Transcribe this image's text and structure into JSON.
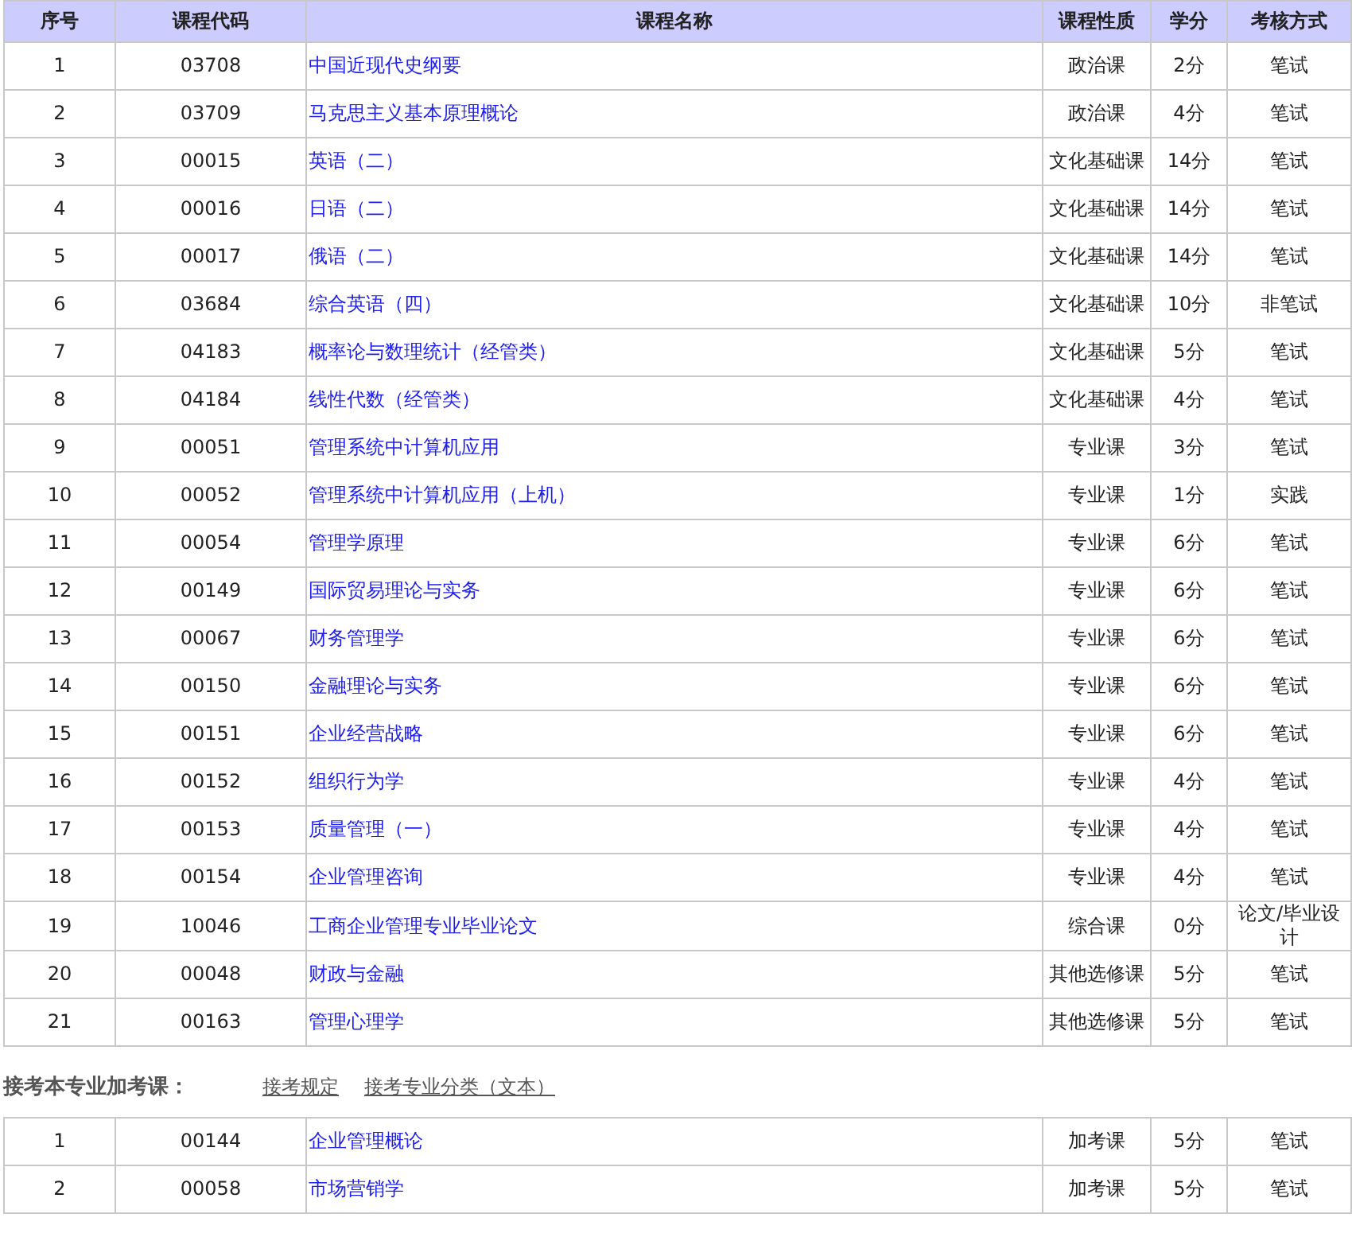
{
  "table": {
    "columns": [
      "序号",
      "课程代码",
      "课程名称",
      "课程性质",
      "学分",
      "考核方式"
    ],
    "rows": [
      [
        "1",
        "03708",
        "中国近现代史纲要",
        "政治课",
        "2分",
        "笔试"
      ],
      [
        "2",
        "03709",
        "马克思主义基本原理概论",
        "政治课",
        "4分",
        "笔试"
      ],
      [
        "3",
        "00015",
        "英语（二）",
        "文化基础课",
        "14分",
        "笔试"
      ],
      [
        "4",
        "00016",
        "日语（二）",
        "文化基础课",
        "14分",
        "笔试"
      ],
      [
        "5",
        "00017",
        "俄语（二）",
        "文化基础课",
        "14分",
        "笔试"
      ],
      [
        "6",
        "03684",
        "综合英语（四）",
        "文化基础课",
        "10分",
        "非笔试"
      ],
      [
        "7",
        "04183",
        "概率论与数理统计（经管类）",
        "文化基础课",
        "5分",
        "笔试"
      ],
      [
        "8",
        "04184",
        "线性代数（经管类）",
        "文化基础课",
        "4分",
        "笔试"
      ],
      [
        "9",
        "00051",
        "管理系统中计算机应用",
        "专业课",
        "3分",
        "笔试"
      ],
      [
        "10",
        "00052",
        "管理系统中计算机应用（上机）",
        "专业课",
        "1分",
        "实践"
      ],
      [
        "11",
        "00054",
        "管理学原理",
        "专业课",
        "6分",
        "笔试"
      ],
      [
        "12",
        "00149",
        "国际贸易理论与实务",
        "专业课",
        "6分",
        "笔试"
      ],
      [
        "13",
        "00067",
        "财务管理学",
        "专业课",
        "6分",
        "笔试"
      ],
      [
        "14",
        "00150",
        "金融理论与实务",
        "专业课",
        "6分",
        "笔试"
      ],
      [
        "15",
        "00151",
        "企业经营战略",
        "专业课",
        "6分",
        "笔试"
      ],
      [
        "16",
        "00152",
        "组织行为学",
        "专业课",
        "4分",
        "笔试"
      ],
      [
        "17",
        "00153",
        "质量管理（一）",
        "专业课",
        "4分",
        "笔试"
      ],
      [
        "18",
        "00154",
        "企业管理咨询",
        "专业课",
        "4分",
        "笔试"
      ],
      [
        "19",
        "10046",
        "工商企业管理专业毕业论文",
        "综合课",
        "0分",
        "论文/毕业设计"
      ],
      [
        "20",
        "00048",
        "财政与金融",
        "其他选修课",
        "5分",
        "笔试"
      ],
      [
        "21",
        "00163",
        "管理心理学",
        "其他选修课",
        "5分",
        "笔试"
      ]
    ]
  },
  "extra_section": {
    "title": "接考本专业加考课：",
    "links": [
      "接考规定",
      "接考专业分类（文本）"
    ],
    "rows": [
      [
        "1",
        "00144",
        "企业管理概论",
        "加考课",
        "5分",
        "笔试"
      ],
      [
        "2",
        "00058",
        "市场营销学",
        "加考课",
        "5分",
        "笔试"
      ]
    ]
  }
}
